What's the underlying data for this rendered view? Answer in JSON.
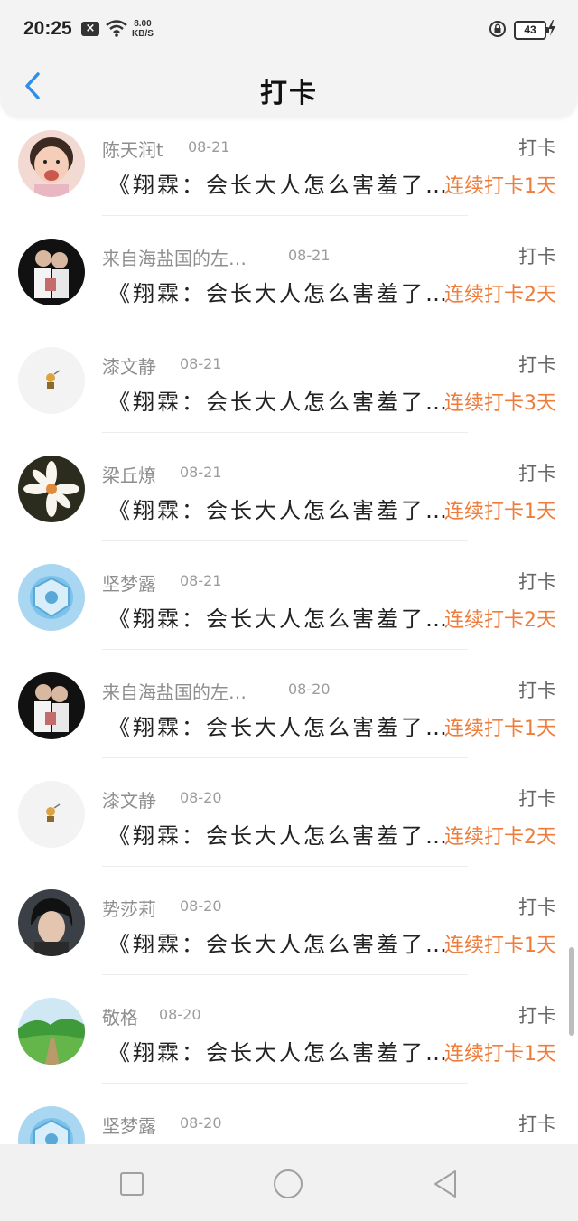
{
  "status_bar": {
    "time": "20:25",
    "speed_value": "8.00",
    "speed_unit": "KB/S",
    "battery": "43"
  },
  "header": {
    "title": "打卡"
  },
  "items": [
    {
      "name": "陈天润t",
      "date": "08-21",
      "tag": "打卡",
      "title": "《翔霖：会长大人怎么害羞了…",
      "streak": "连续打卡1天"
    },
    {
      "name": "来自海盐国的左…",
      "date": "08-21",
      "tag": "打卡",
      "title": "《翔霖：会长大人怎么害羞了…",
      "streak": "连续打卡2天"
    },
    {
      "name": "漆文静",
      "date": "08-21",
      "tag": "打卡",
      "title": "《翔霖：会长大人怎么害羞了…",
      "streak": "连续打卡3天"
    },
    {
      "name": "梁丘燎",
      "date": "08-21",
      "tag": "打卡",
      "title": "《翔霖：会长大人怎么害羞了…",
      "streak": "连续打卡1天"
    },
    {
      "name": "坚梦露",
      "date": "08-21",
      "tag": "打卡",
      "title": "《翔霖：会长大人怎么害羞了…",
      "streak": "连续打卡2天"
    },
    {
      "name": "来自海盐国的左…",
      "date": "08-20",
      "tag": "打卡",
      "title": "《翔霖：会长大人怎么害羞了…",
      "streak": "连续打卡1天"
    },
    {
      "name": "漆文静",
      "date": "08-20",
      "tag": "打卡",
      "title": "《翔霖：会长大人怎么害羞了…",
      "streak": "连续打卡2天"
    },
    {
      "name": "势莎莉",
      "date": "08-20",
      "tag": "打卡",
      "title": "《翔霖：会长大人怎么害羞了…",
      "streak": "连续打卡1天"
    },
    {
      "name": "敬格",
      "date": "08-20",
      "tag": "打卡",
      "title": "《翔霖：会长大人怎么害羞了…",
      "streak": "连续打卡1天"
    },
    {
      "name": "坚梦露",
      "date": "08-20",
      "tag": "打卡",
      "title": "",
      "streak": ""
    }
  ],
  "icons": {
    "back": "chevron-left-icon",
    "nav": [
      "square-icon",
      "circle-icon",
      "triangle-back-icon"
    ]
  },
  "colors": {
    "accent_blue": "#2f8fe6",
    "streak_orange": "#ee7c3b"
  }
}
